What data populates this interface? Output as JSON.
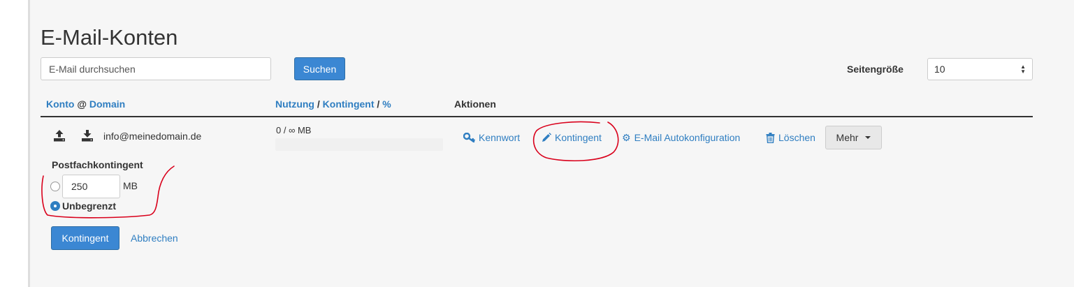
{
  "page": {
    "title": "E-Mail-Konten"
  },
  "search": {
    "placeholder": "E-Mail durchsuchen",
    "button_label": "Suchen"
  },
  "page_size": {
    "label": "Seitengröße",
    "value": "10"
  },
  "table": {
    "headers": {
      "account": "Konto",
      "at": "@",
      "domain": "Domain",
      "usage": "Nutzung",
      "slash1": "/",
      "quota": "Kontingent",
      "slash2": "/",
      "percent": "%",
      "actions": "Aktionen"
    },
    "rows": [
      {
        "email": "info@meinedomain.de",
        "usage_text": "0 / ∞ MB",
        "usage_fraction": 0,
        "icons": [
          "upload-icon",
          "download-icon"
        ],
        "actions": {
          "password": "Kennwort",
          "quota": "Kontingent",
          "autoconfig": "E-Mail Autokonfiguration",
          "delete": "Löschen",
          "more": "Mehr"
        }
      }
    ]
  },
  "quota_form": {
    "title": "Postfachkontingent",
    "quota_value": "250",
    "unit": "MB",
    "unlimited_label": "Unbegrenzt",
    "selected_option": "unlimited",
    "submit_label": "Kontingent",
    "cancel_label": "Abbrechen"
  },
  "colors": {
    "accent": "#3b87d3",
    "link": "#2f7ec1",
    "annotation": "#d9001b"
  }
}
